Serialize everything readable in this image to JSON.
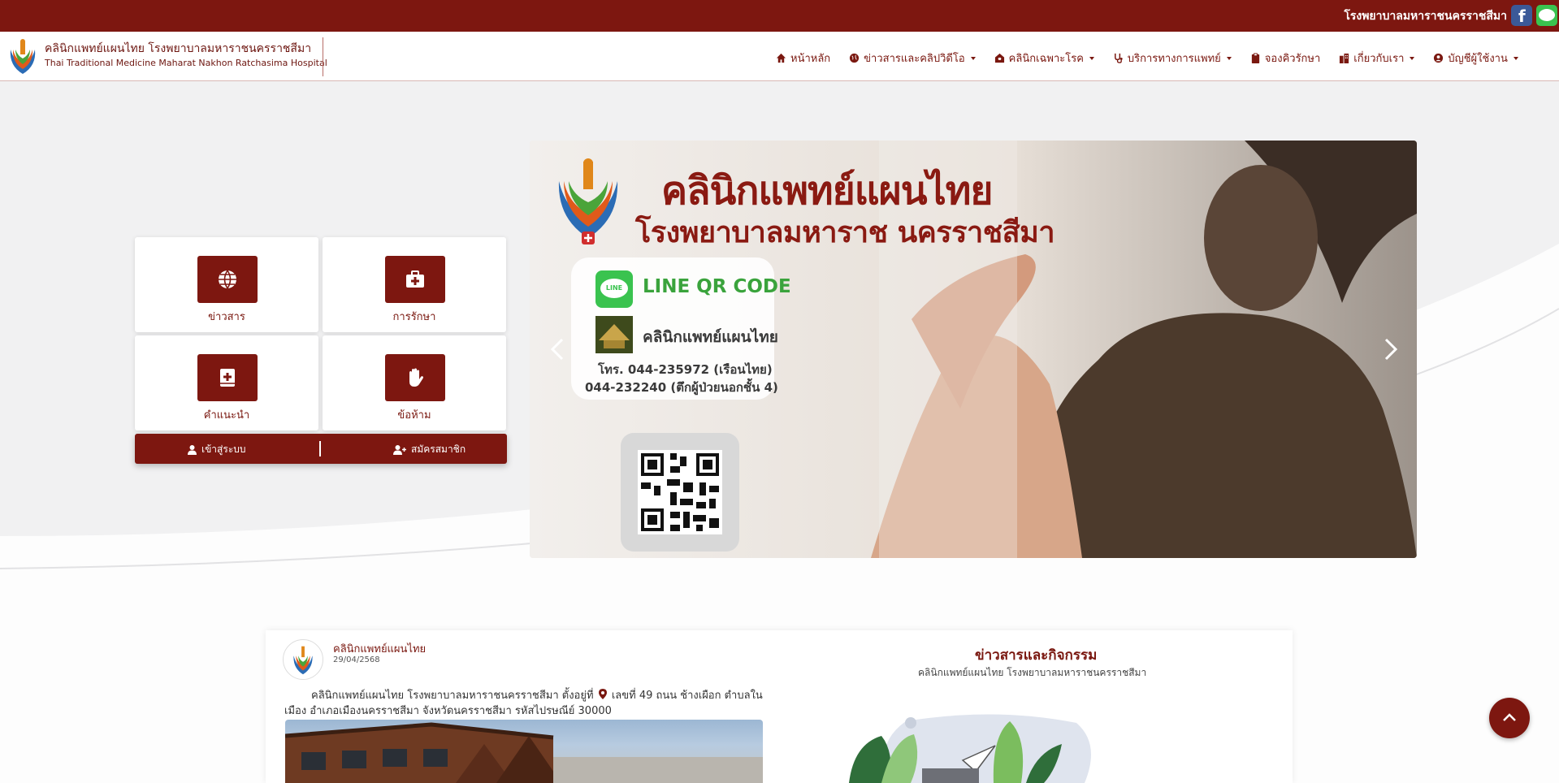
{
  "topbar": {
    "hospital_name": "โรงพยาบาลมหาราชนครราชสีมา",
    "social": [
      "facebook-icon",
      "line-icon"
    ]
  },
  "header": {
    "brand_th": "คลินิกแพทย์แผนไทย โรงพยาบาลมหาราชนครราชสีมา",
    "brand_en": "Thai Traditional Medicine Maharat Nakhon Ratchasima Hospital",
    "nav": [
      {
        "label": "หน้าหลัก",
        "icon": "home-icon",
        "dropdown": false
      },
      {
        "label": "ข่าวสารและคลิปวิดีโอ",
        "icon": "globe-icon",
        "dropdown": true
      },
      {
        "label": "คลินิกเฉพาะโรค",
        "icon": "clinic-icon",
        "dropdown": true
      },
      {
        "label": "บริการทางการแพทย์",
        "icon": "stethoscope-icon",
        "dropdown": true
      },
      {
        "label": "จองคิวรักษา",
        "icon": "clipboard-icon",
        "dropdown": false
      },
      {
        "label": "เกี่ยวกับเรา",
        "icon": "building-icon",
        "dropdown": true
      },
      {
        "label": "บัญชีผู้ใช้งาน",
        "icon": "user-circle-icon",
        "dropdown": true
      }
    ]
  },
  "tiles": [
    {
      "label": "ข่าวสาร",
      "icon": "globe-icon"
    },
    {
      "label": "การรักษา",
      "icon": "medkit-icon"
    },
    {
      "label": "คำแนะนำ",
      "icon": "medical-book-icon"
    },
    {
      "label": "ข้อห้าม",
      "icon": "hand-stop-icon"
    }
  ],
  "auth": {
    "login": "เข้าสู่ระบบ",
    "register": "สมัครสมาชิก"
  },
  "slider": {
    "title_line1": "คลินิกแพทย์แผนไทย",
    "title_line2": "โรงพยาบาลมหาราช นครราชสีมา",
    "line_badge": "LINE",
    "line_qr": "LINE QR CODE",
    "clinic_name": "คลินิกแพทย์แผนไทย",
    "tel1": "โทร. 044-235972 (เรือนไทย)",
    "tel2": "044-232240 (ตึกผู้ป่วยนอกชั้น 4)"
  },
  "post": {
    "author": "คลินิกแพทย์แผนไทย",
    "date": "29/04/2568",
    "text_before_pin": "คลินิกแพทย์แผนไทย โรงพยาบาลมหาราชนครราชสีมา ตั้งอยู่ที่",
    "text_after_pin": "เลขที่ 49 ถนน ช้างเผือก ตำบลใน เมือง อำเภอเมืองนครราชสีมา จังหวัดนครราชสีมา รหัสไปรษณีย์ 30000"
  },
  "section": {
    "title": "ข่าวสารและกิจกรรม",
    "subtitle": "คลินิกแพทย์แผนไทย โรงพยาบาลมหาราชนครราชสีมา"
  },
  "colors": {
    "brand": "#7d1710",
    "line_green": "#3ac34f",
    "facebook_blue": "#3b5998"
  }
}
